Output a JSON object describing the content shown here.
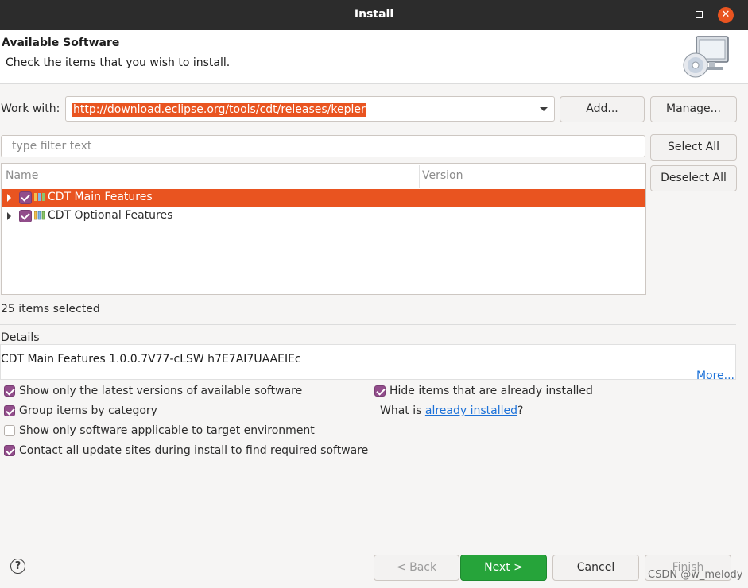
{
  "window": {
    "title": "Install",
    "maximize_icon": "maximize-icon",
    "close_icon": "close-icon",
    "close_glyph": "✕"
  },
  "banner": {
    "heading": "Available Software",
    "subtitle": "Check the items that you wish to install.",
    "icon": "monitor-cd-icon"
  },
  "work_with": {
    "label": "Work with:",
    "value": "http://download.eclipse.org/tools/cdt/releases/kepler",
    "add_label": "Add...",
    "manage_label": "Manage..."
  },
  "filter": {
    "placeholder": "type filter text"
  },
  "buttons": {
    "select_all": "Select All",
    "deselect_all": "Deselect All"
  },
  "tree": {
    "columns": [
      "Name",
      "Version"
    ],
    "rows": [
      {
        "label": "CDT Main Features",
        "checked": true,
        "selected": true
      },
      {
        "label": "CDT Optional Features",
        "checked": true,
        "selected": false
      }
    ]
  },
  "status": {
    "count_text": "25 items selected"
  },
  "details": {
    "label": "Details",
    "text": "CDT Main Features 1.0.0.7V77-cLSW  h7E7AI7UAAEIEc",
    "more_link": "More..."
  },
  "options": {
    "left": [
      {
        "label": "Show only the latest versions of available software",
        "checked": true
      },
      {
        "label": "Group items by category",
        "checked": true
      },
      {
        "label": "Show only software applicable to target environment",
        "checked": false
      },
      {
        "label": "Contact all update sites during install to find required software",
        "checked": true
      }
    ],
    "right": [
      {
        "label": "Hide items that are already installed",
        "checked": true
      }
    ],
    "what_is_prefix": "What is ",
    "what_is_link": "already installed",
    "what_is_suffix": "?"
  },
  "footer": {
    "help_glyph": "?",
    "back": "< Back",
    "next": "Next >",
    "cancel": "Cancel",
    "finish": "Finish",
    "watermark": "CSDN @w_melody"
  },
  "colors": {
    "accent": "#e95420",
    "checkbox": "#924d8b",
    "primary": "#26a43a",
    "link": "#1c71d8"
  }
}
